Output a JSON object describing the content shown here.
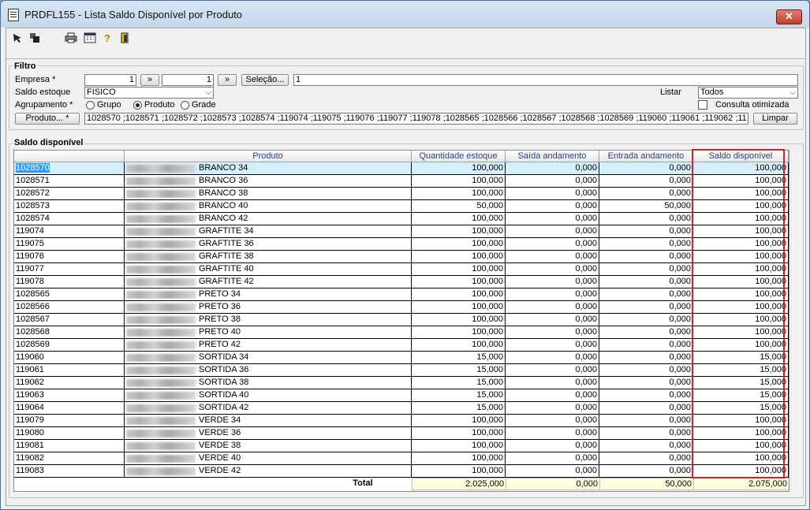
{
  "window": {
    "title": "PRDFL155 - Lista Saldo Disponível por Produto",
    "close": "✕"
  },
  "toolbar": {
    "icons": [
      "arrow-icon",
      "copy-icon",
      "print-icon",
      "calendar-icon",
      "help-icon",
      "exit-icon"
    ]
  },
  "filtro": {
    "label": "Filtro",
    "empresa_label": "Empresa *",
    "empresa_from": "1",
    "empresa_to": "1",
    "arrow1": "»",
    "arrow2": "»",
    "selecao_label": "Seleção...",
    "selecao_value": "1",
    "saldo_label": "Saldo estoque",
    "saldo_value": "FISICO",
    "listar_label": "Listar",
    "listar_value": "Todos",
    "agrupamento_label": "Agrupamento *",
    "opt_grupo": "Grupo",
    "opt_produto": "Produto",
    "opt_grade": "Grade",
    "consulta_label": "Consulta otimizada",
    "produto_btn": "Produto... *",
    "produto_value": "1028570 ;1028571 ;1028572 ;1028573 ;1028574 ;119074 ;119075 ;119076 ;119077 ;119078 ;1028565 ;1028566 ;1028567 ;1028568 ;1028569 ;119060 ;119061 ;119062 ;11",
    "limpar_label": "Limpar"
  },
  "saldo": {
    "label": "Saldo disponível",
    "columns": [
      "Produto",
      "Quantidade estoque",
      "Saída andamento",
      "Entrada andamento",
      "Saldo disponível"
    ],
    "rows": [
      {
        "code": "1028570",
        "desc": "BRANCO 34",
        "qtd": "100,000",
        "saida": "0,000",
        "entrada": "0,000",
        "saldo": "100,000"
      },
      {
        "code": "1028571",
        "desc": "BRANCO 36",
        "qtd": "100,000",
        "saida": "0,000",
        "entrada": "0,000",
        "saldo": "100,000"
      },
      {
        "code": "1028572",
        "desc": "BRANCO 38",
        "qtd": "100,000",
        "saida": "0,000",
        "entrada": "0,000",
        "saldo": "100,000"
      },
      {
        "code": "1028573",
        "desc": "BRANCO 40",
        "qtd": "50,000",
        "saida": "0,000",
        "entrada": "50,000",
        "saldo": "100,000"
      },
      {
        "code": "1028574",
        "desc": "BRANCO 42",
        "qtd": "100,000",
        "saida": "0,000",
        "entrada": "0,000",
        "saldo": "100,000"
      },
      {
        "code": "119074",
        "desc": "GRAFTITE 34",
        "qtd": "100,000",
        "saida": "0,000",
        "entrada": "0,000",
        "saldo": "100,000"
      },
      {
        "code": "119075",
        "desc": "GRAFTITE 36",
        "qtd": "100,000",
        "saida": "0,000",
        "entrada": "0,000",
        "saldo": "100,000"
      },
      {
        "code": "119076",
        "desc": "GRAFTITE 38",
        "qtd": "100,000",
        "saida": "0,000",
        "entrada": "0,000",
        "saldo": "100,000"
      },
      {
        "code": "119077",
        "desc": "GRAFTITE 40",
        "qtd": "100,000",
        "saida": "0,000",
        "entrada": "0,000",
        "saldo": "100,000"
      },
      {
        "code": "119078",
        "desc": "GRAFTITE 42",
        "qtd": "100,000",
        "saida": "0,000",
        "entrada": "0,000",
        "saldo": "100,000"
      },
      {
        "code": "1028565",
        "desc": "PRETO 34",
        "qtd": "100,000",
        "saida": "0,000",
        "entrada": "0,000",
        "saldo": "100,000"
      },
      {
        "code": "1028566",
        "desc": "PRETO 36",
        "qtd": "100,000",
        "saida": "0,000",
        "entrada": "0,000",
        "saldo": "100,000"
      },
      {
        "code": "1028567",
        "desc": "PRETO 38",
        "qtd": "100,000",
        "saida": "0,000",
        "entrada": "0,000",
        "saldo": "100,000"
      },
      {
        "code": "1028568",
        "desc": "PRETO 40",
        "qtd": "100,000",
        "saida": "0,000",
        "entrada": "0,000",
        "saldo": "100,000"
      },
      {
        "code": "1028569",
        "desc": "PRETO 42",
        "qtd": "100,000",
        "saida": "0,000",
        "entrada": "0,000",
        "saldo": "100,000"
      },
      {
        "code": "119060",
        "desc": "SORTIDA 34",
        "qtd": "15,000",
        "saida": "0,000",
        "entrada": "0,000",
        "saldo": "15,000"
      },
      {
        "code": "119061",
        "desc": "SORTIDA 36",
        "qtd": "15,000",
        "saida": "0,000",
        "entrada": "0,000",
        "saldo": "15,000"
      },
      {
        "code": "119062",
        "desc": "SORTIDA 38",
        "qtd": "15,000",
        "saida": "0,000",
        "entrada": "0,000",
        "saldo": "15,000"
      },
      {
        "code": "119063",
        "desc": "SORTIDA 40",
        "qtd": "15,000",
        "saida": "0,000",
        "entrada": "0,000",
        "saldo": "15,000"
      },
      {
        "code": "119064",
        "desc": "SORTIDA 42",
        "qtd": "15,000",
        "saida": "0,000",
        "entrada": "0,000",
        "saldo": "15,000"
      },
      {
        "code": "119079",
        "desc": "VERDE 34",
        "qtd": "100,000",
        "saida": "0,000",
        "entrada": "0,000",
        "saldo": "100,000"
      },
      {
        "code": "119080",
        "desc": "VERDE 36",
        "qtd": "100,000",
        "saida": "0,000",
        "entrada": "0,000",
        "saldo": "100,000"
      },
      {
        "code": "119081",
        "desc": "VERDE 38",
        "qtd": "100,000",
        "saida": "0,000",
        "entrada": "0,000",
        "saldo": "100,000"
      },
      {
        "code": "119082",
        "desc": "VERDE 40",
        "qtd": "100,000",
        "saida": "0,000",
        "entrada": "0,000",
        "saldo": "100,000"
      },
      {
        "code": "119083",
        "desc": "VERDE 42",
        "qtd": "100,000",
        "saida": "0,000",
        "entrada": "0,000",
        "saldo": "100,000"
      }
    ],
    "total": {
      "label": "Total",
      "qtd": "2.025,000",
      "saida": "0,000",
      "entrada": "50,000",
      "saldo": "2.075,000"
    }
  }
}
